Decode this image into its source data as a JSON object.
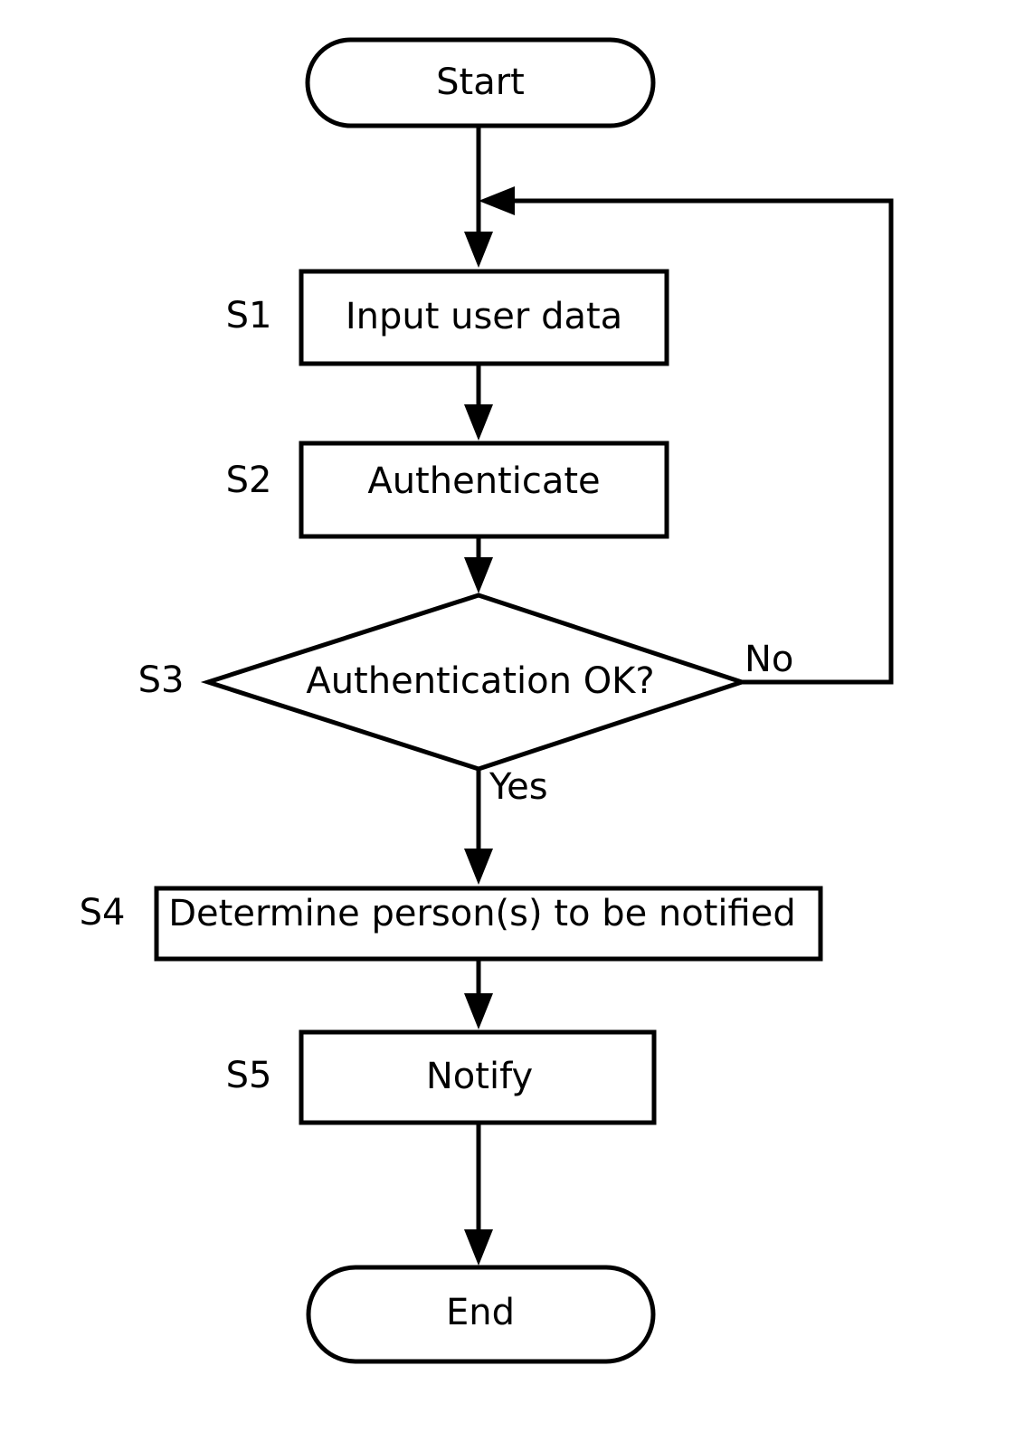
{
  "diagram": {
    "type": "flowchart",
    "orientation": "top-to-bottom",
    "background_color": "#ffffff",
    "line_color": "#000000",
    "text_color": "#000000",
    "nodes": [
      {
        "id": "start",
        "shape": "terminator",
        "label": "Start",
        "step": ""
      },
      {
        "id": "s1",
        "shape": "process",
        "label": "Input user data",
        "step": "S1"
      },
      {
        "id": "s2",
        "shape": "process",
        "label": "Authenticate",
        "step": "S2"
      },
      {
        "id": "s3",
        "shape": "decision",
        "label": "Authentication OK?",
        "step": "S3"
      },
      {
        "id": "s4",
        "shape": "process",
        "label": "Determine person(s) to be notified",
        "step": "S4"
      },
      {
        "id": "s5",
        "shape": "process",
        "label": "Notify",
        "step": "S5"
      },
      {
        "id": "end",
        "shape": "terminator",
        "label": "End",
        "step": ""
      }
    ],
    "edge_labels": {
      "decision_no": "No",
      "decision_yes": "Yes"
    },
    "edges": [
      {
        "from": "start",
        "to": "s1",
        "label": ""
      },
      {
        "from": "s1",
        "to": "s2",
        "label": ""
      },
      {
        "from": "s2",
        "to": "s3",
        "label": ""
      },
      {
        "from": "s3",
        "to": "s4",
        "label": "Yes"
      },
      {
        "from": "s3",
        "to": "s1",
        "label": "No"
      },
      {
        "from": "s4",
        "to": "s5",
        "label": ""
      },
      {
        "from": "s5",
        "to": "end",
        "label": ""
      }
    ]
  }
}
